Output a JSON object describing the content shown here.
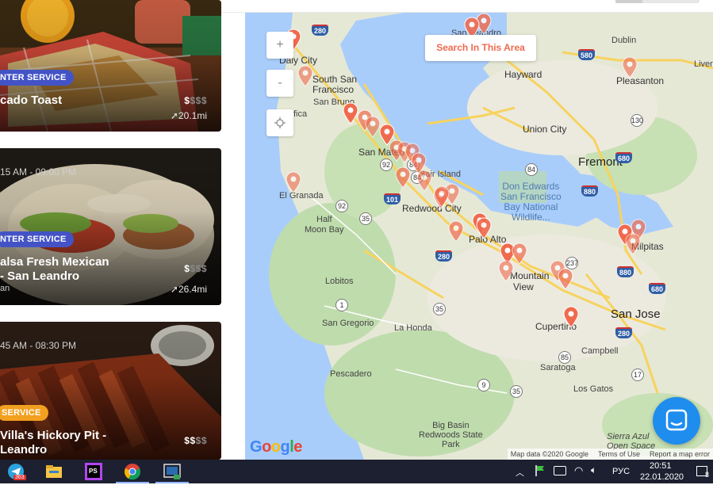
{
  "cards": [
    {
      "badge": "NTER SERVICE",
      "badge_color": "#4353c6",
      "title_lines": [
        "cado Toast"
      ],
      "price_bold": "$",
      "price_dim": "$$$",
      "distance": "20.1mi"
    },
    {
      "hours": "15 AM - 09:00 PM",
      "badge": "NTER SERVICE",
      "badge_color": "#4353c6",
      "title_lines": [
        "alsa Fresh Mexican",
        "- San Leandro"
      ],
      "sub": "an",
      "price_bold": "$",
      "price_dim": "$$$",
      "distance": "26.4mi"
    },
    {
      "hours": "45 AM - 08:30 PM",
      "badge": "SERVICE",
      "badge_color": "#f2a01f",
      "title_lines": [
        "Villa's Hickory Pit -",
        "Leandro"
      ],
      "price_bold": "$$",
      "price_dim": "$$"
    }
  ],
  "map": {
    "zoom_in": "+",
    "zoom_out": "-",
    "locate_icon": "crosshair-icon",
    "search_button": "Search In This Area",
    "accent": "#f06a4e",
    "labels": {
      "daly_city": "Daly City",
      "south_sf_1": "South San",
      "south_sf_2": "Francisco",
      "san_bruno": "San Bruno",
      "pacifica": "fica",
      "san_mateo": "San Mateo",
      "el_granada": "El Granada",
      "half_moon_bay_1": "Half",
      "half_moon_bay_2": "Moon Bay",
      "redwood_city": "Redwood City",
      "bair_island": "Bair Island",
      "palo_alto": "Palo Alto",
      "mountain_view_1": "Mountain",
      "mountain_view_2": "View",
      "lobitos": "Lobitos",
      "san_gregorio": "San Gregorio",
      "la_honda": "La Honda",
      "pescadero": "Pescadero",
      "big_basin_1": "Big Basin",
      "big_basin_2": "Redwoods State",
      "big_basin_3": "Park",
      "cupertino": "Cupertino",
      "san_jose": "San Jose",
      "campbell": "Campbell",
      "saratoga": "Saratoga",
      "los_gatos": "Los Gatos",
      "milpitas": "Milpitas",
      "fremont": "Fremont",
      "union_city": "Union City",
      "hayward": "Hayward",
      "dublin": "Dublin",
      "pleasanton": "Pleasanton",
      "livermore": "Liverm",
      "san_leandro": "San Leandro",
      "don_edwards_1": "Don Edwards",
      "don_edwards_2": "San Francisco",
      "don_edwards_3": "Bay National",
      "don_edwards_4": "Wildlife...",
      "sierra_azul_1": "Sierra Azul",
      "sierra_azul_2": "Open Space"
    },
    "shields": [
      "280",
      "580",
      "880",
      "680",
      "101",
      "92",
      "84",
      "237",
      "85",
      "17",
      "1",
      "35",
      "9",
      "130"
    ],
    "google_logo": "Google",
    "attribution": {
      "map_data": "Map data ©2020 Google",
      "terms": "Terms of Use",
      "report": "Report a map error"
    }
  },
  "taskbar": {
    "apps": [
      "telegram-icon",
      "file-explorer-icon",
      "phpstorm-icon",
      "chrome-icon",
      "app-icon"
    ],
    "telegram_badge": "363",
    "language": "РУС",
    "time": "20:51",
    "date": "22.01.2020",
    "notification_count": "8"
  }
}
